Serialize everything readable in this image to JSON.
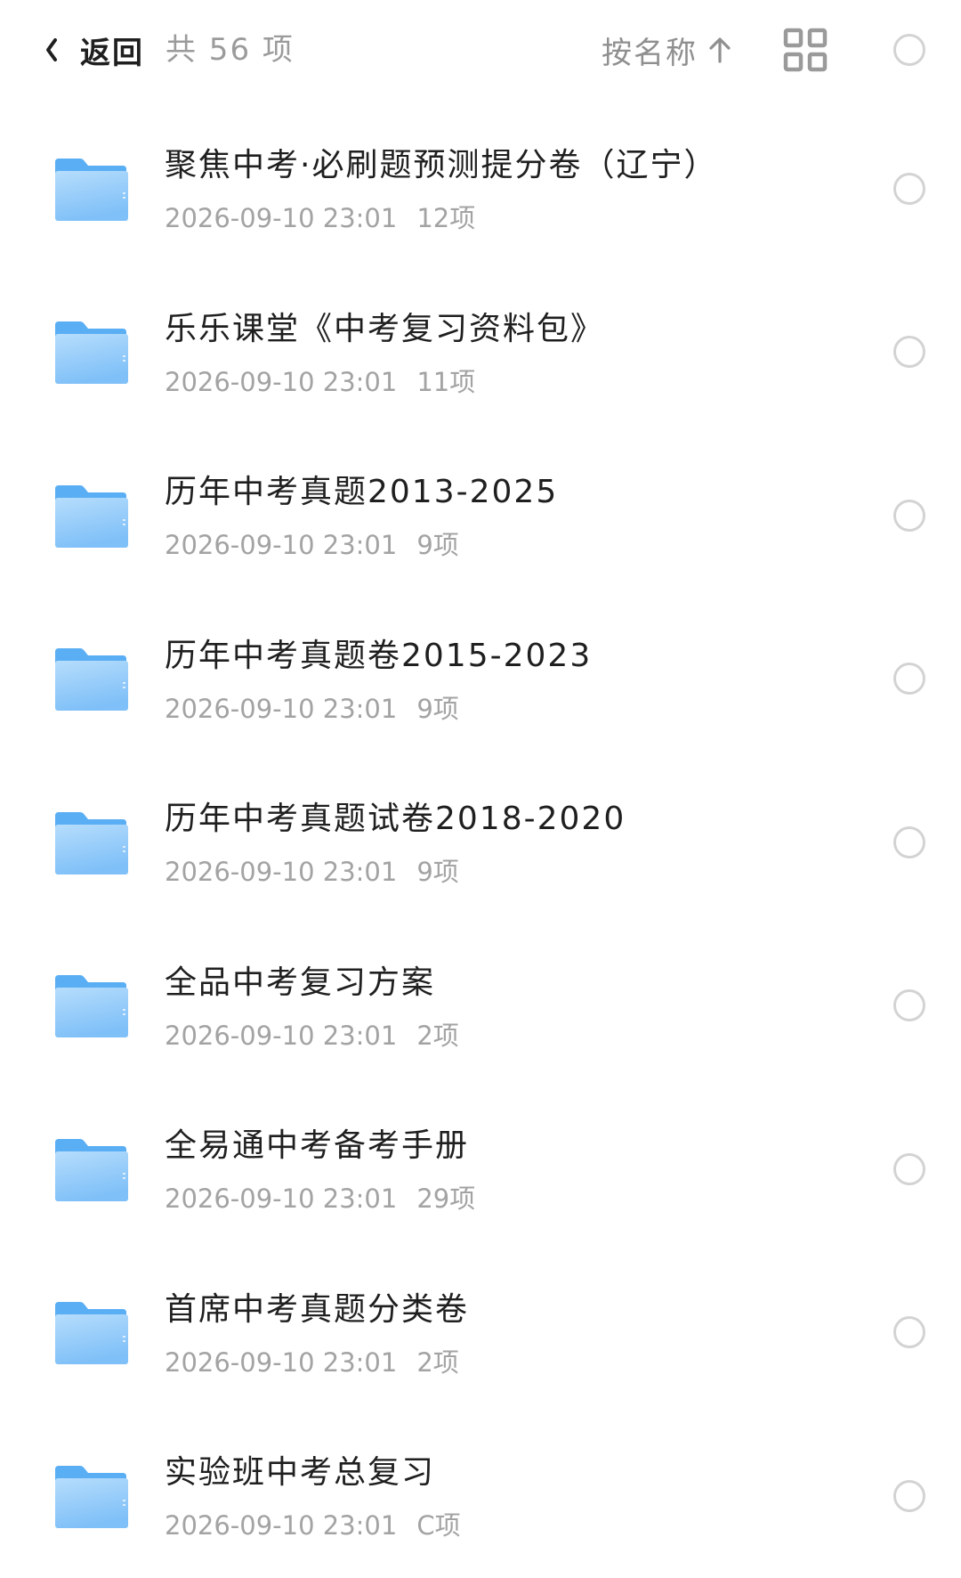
{
  "header": {
    "back_label": "返回",
    "count_label": "共 56 项",
    "sort_label": "按名称",
    "icons": {
      "back": "chevron-left-icon",
      "sort": "arrow-up-icon",
      "view": "grid-view-icon",
      "select": "circle-checkbox-icon"
    }
  },
  "folders": [
    {
      "name": "聚焦中考·必刷题预测提分卷（辽宁）",
      "date": "2026-09-10 23:01",
      "count": "12项"
    },
    {
      "name": "乐乐课堂《中考复习资料包》",
      "date": "2026-09-10 23:01",
      "count": "11项"
    },
    {
      "name": "历年中考真题2013-2025",
      "date": "2026-09-10 23:01",
      "count": "9项"
    },
    {
      "name": "历年中考真题卷2015-2023",
      "date": "2026-09-10 23:01",
      "count": "9项"
    },
    {
      "name": "历年中考真题试卷2018-2020",
      "date": "2026-09-10 23:01",
      "count": "9项"
    },
    {
      "name": "全品中考复习方案",
      "date": "2026-09-10 23:01",
      "count": "2项"
    },
    {
      "name": "全易通中考备考手册",
      "date": "2026-09-10 23:01",
      "count": "29项"
    },
    {
      "name": "首席中考真题分类卷",
      "date": "2026-09-10 23:01",
      "count": "2项"
    },
    {
      "name": "实验班中考总复习",
      "date": "2026-09-10 23:01",
      "count": "C项"
    }
  ],
  "colors": {
    "folder_light": "#a9d6fb",
    "folder_dark": "#5aaef4",
    "text_primary": "#1f1f1f",
    "text_secondary": "#a3a3a3",
    "checkbox_border": "#d3d3d3"
  }
}
